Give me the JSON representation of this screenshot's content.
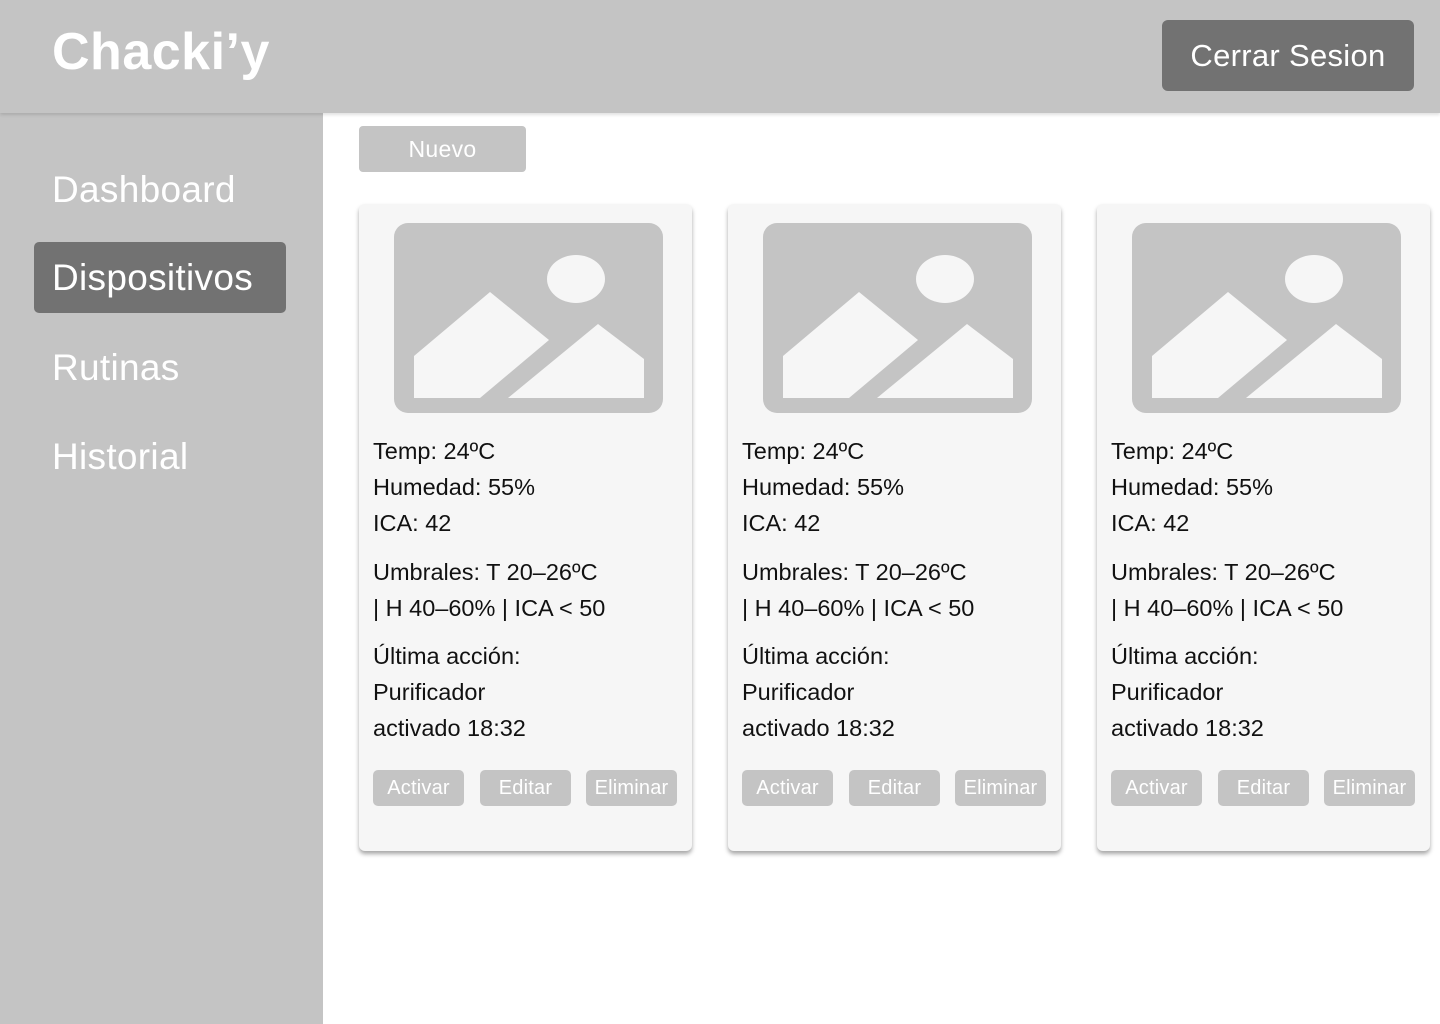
{
  "app": {
    "logo": "Chacki’y",
    "logout_label": "Cerrar Sesion"
  },
  "sidebar": {
    "items": [
      {
        "label": "Dashboard",
        "active": false
      },
      {
        "label": "Dispositivos",
        "active": true
      },
      {
        "label": "Rutinas",
        "active": false
      },
      {
        "label": "Historial",
        "active": false
      }
    ]
  },
  "main": {
    "new_label": "Nuevo"
  },
  "cards": [
    {
      "image_icon": "image-placeholder-icon",
      "temp": "Temp: 24ºC",
      "humidity": "Humedad: 55%",
      "ica": "ICA: 42",
      "thresholds_line1": "Umbrales: T 20–26ºC",
      "thresholds_line2": "| H 40–60% | ICA < 50",
      "last_action_line1": "Última acción:",
      "last_action_line2": "Purificador",
      "last_action_line3": "activado 18:32",
      "activate_label": "Activar",
      "edit_label": "Editar",
      "delete_label": "Eliminar"
    },
    {
      "image_icon": "image-placeholder-icon",
      "temp": "Temp: 24ºC",
      "humidity": "Humedad: 55%",
      "ica": "ICA: 42",
      "thresholds_line1": "Umbrales: T 20–26ºC",
      "thresholds_line2": "| H 40–60% | ICA < 50",
      "last_action_line1": "Última acción:",
      "last_action_line2": "Purificador",
      "last_action_line3": "activado 18:32",
      "activate_label": "Activar",
      "edit_label": "Editar",
      "delete_label": "Eliminar"
    },
    {
      "image_icon": "image-placeholder-icon",
      "temp": "Temp: 24ºC",
      "humidity": "Humedad: 55%",
      "ica": "ICA: 42",
      "thresholds_line1": "Umbrales: T 20–26ºC",
      "thresholds_line2": "| H 40–60% | ICA < 50",
      "last_action_line1": "Última acción:",
      "last_action_line2": "Purificador",
      "last_action_line3": "activado 18:32",
      "activate_label": "Activar",
      "edit_label": "Editar",
      "delete_label": "Eliminar"
    }
  ],
  "colors": {
    "panel_gray": "#c4c4c4",
    "dark_gray": "#727272",
    "card_bg": "#f6f6f6"
  }
}
